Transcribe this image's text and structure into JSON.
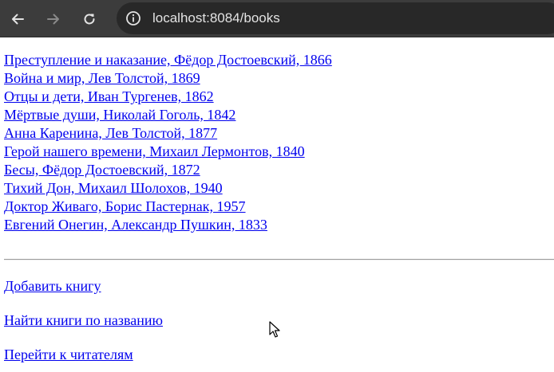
{
  "browser": {
    "url": "localhost:8084/books",
    "icons": {
      "back": "arrow-left-icon",
      "forward": "arrow-right-icon",
      "reload": "reload-icon",
      "site_info": "info-icon"
    },
    "colors": {
      "toolbar": "#3c3c3c",
      "omnibox": "#282828",
      "icon": "#e3e3e3",
      "icon_disabled": "#8a8a8a"
    }
  },
  "page": {
    "books": [
      {
        "label": "Преступление и наказание, Фёдор Достоевский, 1866"
      },
      {
        "label": "Война и мир, Лев Толстой, 1869"
      },
      {
        "label": "Отцы и дети, Иван Тургенев, 1862"
      },
      {
        "label": "Мёртвые души, Николай Гоголь, 1842"
      },
      {
        "label": "Анна Каренина, Лев Толстой, 1877"
      },
      {
        "label": "Герой нашего времени, Михаил Лермонтов, 1840"
      },
      {
        "label": "Бесы, Фёдор Достоевский, 1872"
      },
      {
        "label": "Тихий Дон, Михаил Шолохов, 1940"
      },
      {
        "label": "Доктор Живаго, Борис Пастернак, 1957"
      },
      {
        "label": "Евгений Онегин, Александр Пушкин, 1833"
      }
    ],
    "actions": {
      "add_book": "Добавить книгу",
      "find_books": "Найти книги по названию",
      "go_to_readers": "Перейти к читателям"
    },
    "colors": {
      "link": "#0000ee",
      "background": "#ffffff"
    }
  }
}
